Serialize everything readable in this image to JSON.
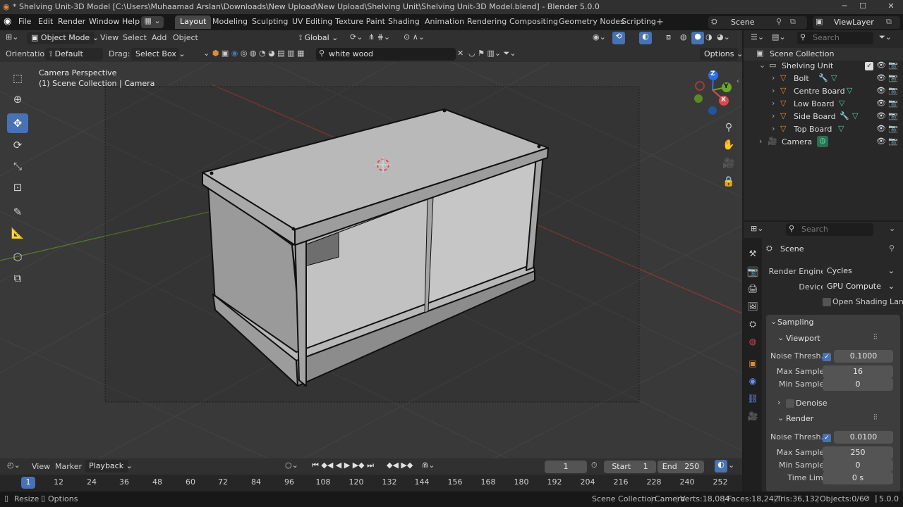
{
  "window": {
    "title": "* Shelving Unit-3D Model [C:\\Users\\Muhaamad Arslan\\Downloads\\New Upload\\New Upload\\Shelving Unit\\Shelving Unit-3D Model.blend] - Blender 5.0.0"
  },
  "menu": {
    "items": [
      "File",
      "Edit",
      "Render",
      "Window",
      "Help"
    ]
  },
  "workspaces": [
    "Layout",
    "Modeling",
    "Sculpting",
    "UV Editing",
    "Texture Paint",
    "Shading",
    "Animation",
    "Rendering",
    "Compositing",
    "Geometry Nodes",
    "Scripting"
  ],
  "scene": {
    "name": "Scene",
    "view_layer": "ViewLayer"
  },
  "viewport_header": {
    "mode": "Object Mode",
    "menus": [
      "View",
      "Select",
      "Add",
      "Object"
    ],
    "transform": "Global"
  },
  "tool_settings": {
    "orientation_label": "Orientation:",
    "orientation_value": "Default",
    "drag_label": "Drag:",
    "drag_value": "Select Box",
    "search_value": "white wood",
    "options": "Options"
  },
  "viewport": {
    "camera_label": "Camera Perspective",
    "collection_label": "(1) Scene Collection | Camera"
  },
  "gizmo": {
    "z": "Z",
    "y": "Y",
    "x": "X"
  },
  "outliner": {
    "search_placeholder": "Search",
    "root": "Scene Collection",
    "collection": "Shelving Unit",
    "objects": [
      "Bolt",
      "Centre Board",
      "Low Board",
      "Side Board",
      "Top Board"
    ],
    "camera": "Camera"
  },
  "properties": {
    "search_placeholder": "Search",
    "context": "Scene",
    "render_engine_label": "Render Engine",
    "render_engine": "Cycles",
    "device_label": "Device",
    "device": "GPU Compute",
    "osl_label": "Open Shading Lan...",
    "sampling": "Sampling",
    "viewport": "Viewport",
    "noise_label": "Noise Thresh...",
    "viewport_noise": "0.1000",
    "max_samples_label": "Max Samples",
    "viewport_max": "16",
    "min_samples_label": "Min Samples",
    "viewport_min": "0",
    "denoise": "Denoise",
    "render": "Render",
    "render_noise": "0.0100",
    "render_max": "250",
    "render_min": "0",
    "time_limit_label": "Time Limit",
    "time_limit": "0 s"
  },
  "timeline": {
    "menus": [
      "View",
      "Marker",
      "Playback"
    ],
    "current_frame": "1",
    "start_label": "Start",
    "start": "1",
    "end_label": "End",
    "end": "250",
    "frames": [
      "1",
      "12",
      "24",
      "36",
      "48",
      "60",
      "72",
      "84",
      "96",
      "108",
      "120",
      "132",
      "144",
      "156",
      "168",
      "180",
      "192",
      "204",
      "216",
      "228",
      "240",
      "252"
    ]
  },
  "status": {
    "resize": "Resize",
    "options": "Options",
    "collection": "Scene Collection",
    "camera": "Camera",
    "verts": "Verts:18,084",
    "faces": "Faces:18,242",
    "tris": "Tris:36,132",
    "objects": "Objects:0/6",
    "version": "5.0.0"
  },
  "colors": {
    "accent": "#4772b3",
    "object_orange": "#e08a3c",
    "mesh_green": "#4fc99a",
    "modifier_blue": "#6f8ff5"
  }
}
